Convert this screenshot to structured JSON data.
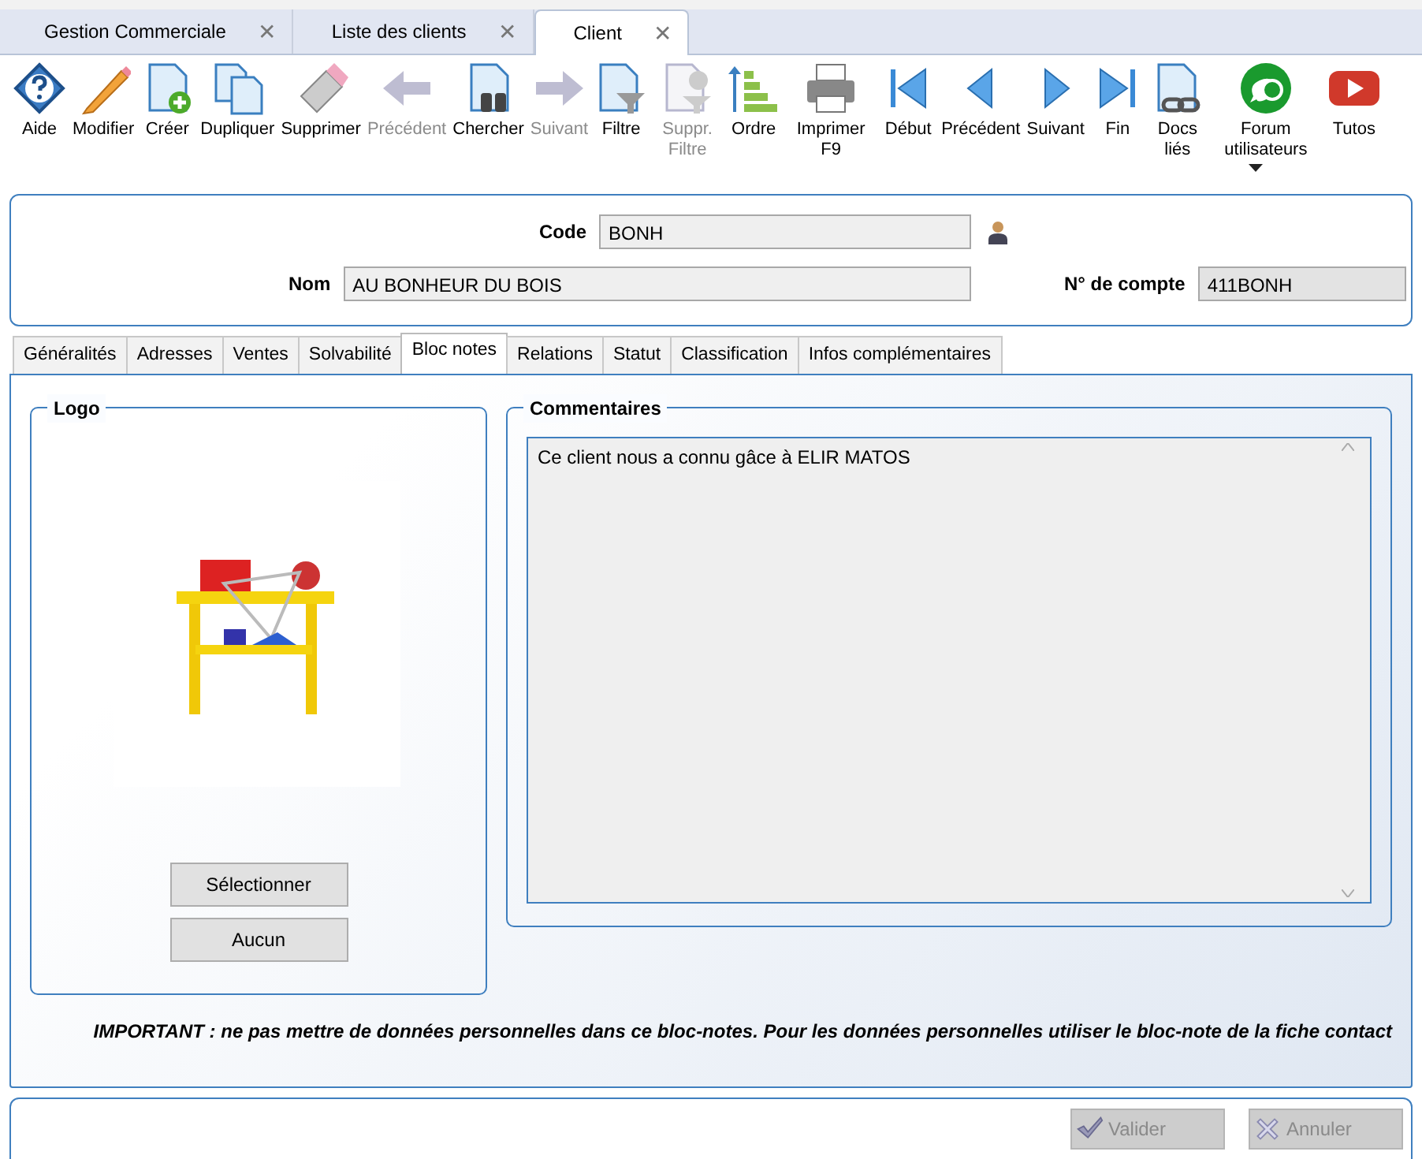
{
  "window_tabs": [
    {
      "label": "Gestion Commerciale",
      "close": "✕",
      "selected": false
    },
    {
      "label": "Liste des clients",
      "close": "✕",
      "selected": false
    },
    {
      "label": "Client",
      "close": "✕",
      "selected": true
    }
  ],
  "toolbar": [
    {
      "kind": "help",
      "label": "Aide",
      "disabled": false
    },
    {
      "kind": "pencil",
      "label": "Modifier",
      "disabled": false
    },
    {
      "kind": "newdoc",
      "label": "Créer",
      "disabled": false
    },
    {
      "kind": "copydoc",
      "label": "Dupliquer",
      "disabled": false
    },
    {
      "kind": "eraser",
      "label": "Supprimer",
      "disabled": false
    },
    {
      "kind": "bigleft",
      "label": "Précédent",
      "disabled": true
    },
    {
      "kind": "binoc",
      "label": "Chercher",
      "disabled": false
    },
    {
      "kind": "bigright",
      "label": "Suivant",
      "disabled": true
    },
    {
      "kind": "filter",
      "label": "Filtre",
      "disabled": false
    },
    {
      "kind": "nofilter",
      "label": "Suppr. Filtre",
      "disabled": true
    },
    {
      "kind": "order",
      "label": "Ordre",
      "disabled": false
    },
    {
      "kind": "printer",
      "label": "Imprimer F9",
      "disabled": false
    },
    {
      "kind": "first",
      "label": "Début",
      "disabled": false
    },
    {
      "kind": "prev",
      "label": "Précédent",
      "disabled": false
    },
    {
      "kind": "next",
      "label": "Suivant",
      "disabled": false
    },
    {
      "kind": "last",
      "label": "Fin",
      "disabled": false
    },
    {
      "kind": "linkdoc",
      "label": "Docs liés",
      "disabled": false
    },
    {
      "kind": "forum",
      "label": "Forum utilisateurs",
      "disabled": false
    },
    {
      "kind": "video",
      "label": "Tutos",
      "disabled": false
    }
  ],
  "header": {
    "code_label": "Code",
    "code_value": "BONH",
    "nom_label": "Nom",
    "nom_value": "AU BONHEUR DU BOIS",
    "compte_label": "N° de compte",
    "compte_value": "411BONH"
  },
  "tabs": [
    {
      "label": "Généralités",
      "selected": false
    },
    {
      "label": "Adresses",
      "selected": false
    },
    {
      "label": "Ventes",
      "selected": false
    },
    {
      "label": "Solvabilité",
      "selected": false
    },
    {
      "label": "Bloc notes",
      "selected": true
    },
    {
      "label": "Relations",
      "selected": false
    },
    {
      "label": "Statut",
      "selected": false
    },
    {
      "label": "Classification",
      "selected": false
    },
    {
      "label": "Infos complémentaires",
      "selected": false
    }
  ],
  "logo": {
    "title": "Logo",
    "image": {
      "kind": "picture"
    },
    "buttons": [
      "Sélectionner",
      "Aucun"
    ]
  },
  "comments": {
    "title": "Commentaires",
    "value": "Ce client nous a connu gâce à ELIR MATOS"
  },
  "notice": "IMPORTANT : ne pas mettre de données personnelles dans ce bloc-notes. Pour les données personnelles utiliser le bloc-note de la fiche contact",
  "footer": [
    {
      "kind": "check",
      "label": "Valider",
      "disabled": true
    },
    {
      "kind": "cross",
      "label": "Annuler",
      "disabled": true
    }
  ]
}
